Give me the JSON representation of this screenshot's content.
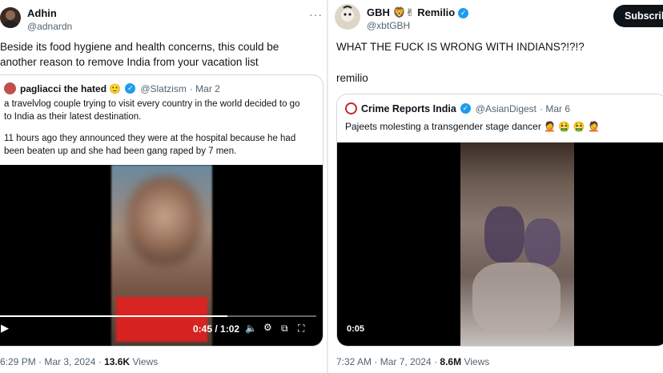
{
  "left_tweet": {
    "author_name": "Adhin",
    "author_handle": "@adnardn",
    "menu": "···",
    "text": "Beside its food hygiene and health concerns, this could be another reason to remove India from your vacation list",
    "quote": {
      "name": "pagliacci the hated 🙂",
      "handle": "@Slatzism",
      "date": "· Mar 2",
      "text_1": "a travelvlog couple trying to visit every country in the world decided to go to India as their latest destination.",
      "text_2": "11 hours ago they announced they were at the hospital because he had been beaten up and she had been gang raped by 7 men."
    },
    "video": {
      "time": "0:45 / 1:02",
      "progress": 0.72
    },
    "timestamp": "6:29 PM · Mar 3, 2024 ·",
    "views_count": "13.6K",
    "views_label": "Views"
  },
  "right_tweet": {
    "author_name": "GBH 🦁✌ Remilio",
    "author_handle": "@xbtGBH",
    "subscribe_label": "Subscribe",
    "text_1": "WHAT THE FUCK IS WRONG WITH INDIANS?!?!?",
    "text_2": "remilio",
    "quote": {
      "name": "Crime Reports India",
      "handle": "@AsianDigest",
      "date": "· Mar 6",
      "text": "Pajeets molesting a transgender stage dancer 🤦 🤮 🤮 🤦"
    },
    "video": {
      "time": "0:05"
    },
    "timestamp": "7:32 AM · Mar 7, 2024 ·",
    "views_count": "8.6M",
    "views_label": "Views"
  },
  "colors": {
    "verified": "#1d9bf0",
    "secondary_text": "#536471",
    "border": "#cfd9de",
    "video_overlay": "#e41f1f"
  }
}
